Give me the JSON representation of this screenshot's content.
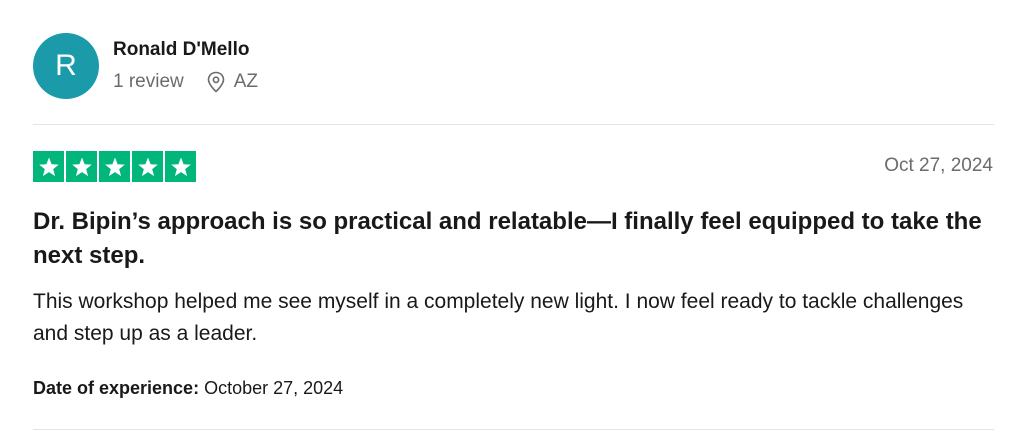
{
  "reviewer": {
    "avatar_initial": "R",
    "avatar_color": "#1b9aaa",
    "name": "Ronald D'Mello",
    "review_count": "1 review",
    "location": "AZ",
    "location_icon": "map-pin-icon"
  },
  "review": {
    "rating": 5,
    "rating_max": 5,
    "star_color": "#00b67a",
    "date": "Oct 27, 2024",
    "title": "Dr. Bipin’s approach is so practical and relatable—I finally feel equipped to take the next step.",
    "body": "This workshop helped me see myself in a completely new light. I now feel ready to tackle challenges and step up as a leader.",
    "experience_label": "Date of experience:",
    "experience_date": "October 27, 2024"
  }
}
